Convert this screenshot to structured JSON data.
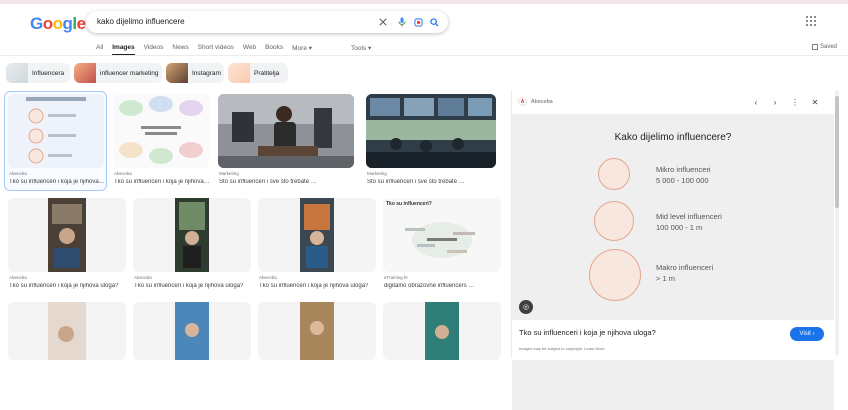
{
  "logo": {
    "letters": [
      "G",
      "o",
      "o",
      "g",
      "l",
      "e"
    ],
    "colors": [
      "#4285f4",
      "#ea4335",
      "#fbbc05",
      "#4285f4",
      "#34a853",
      "#ea4335"
    ]
  },
  "search": {
    "query": "kako dijelimo influencere"
  },
  "tabs": [
    "All",
    "Images",
    "Videos",
    "News",
    "Short videos",
    "Web",
    "Books",
    "More ▾"
  ],
  "tools_label": "Tools ▾",
  "saved_label": "Saved",
  "chips": [
    "Influencera",
    "influencer marketing",
    "Instagram",
    "Pratitelja"
  ],
  "results": [
    {
      "source": "Abeceba",
      "title": "Tko su influenceri i koja je njihova…"
    },
    {
      "source": "Abeceba",
      "title": "Tko su influenceri i koja je njihova…"
    },
    {
      "source": "Marketing",
      "title": "Što su influenceri i sve što trebate …"
    },
    {
      "source": "Marketing",
      "title": "Što su influenceri i sve što trebate …"
    },
    {
      "source": "Abeceba",
      "title": "Tko su influenceri i koja je njihova uloga?"
    },
    {
      "source": "Abeceba",
      "title": "Tko su influenceri i koja je njihova uloga?"
    },
    {
      "source": "Abeceba",
      "title": "Tko su influenceri i koja je njihova uloga?"
    },
    {
      "source": "eTraining.hr",
      "title": "digitalno obrazovne influencers …"
    }
  ],
  "thumb2_text": "Tko su influenceri?",
  "panel": {
    "source": "Abeceba",
    "preview_title": "Kako dijelimo influencere?",
    "items": [
      {
        "line1": "Mikro influenceri",
        "line2": "5 000 - 100 000"
      },
      {
        "line1": "Mid level influenceri",
        "line2": "100 000 - 1 m"
      },
      {
        "line1": "Makro influenceri",
        "line2": "> 1 m"
      }
    ],
    "title": "Tko su influenceri i koja je njihova uloga?",
    "copyright": "Images may be subject to copyright. Learn More",
    "visit_label": "Visit ›"
  }
}
